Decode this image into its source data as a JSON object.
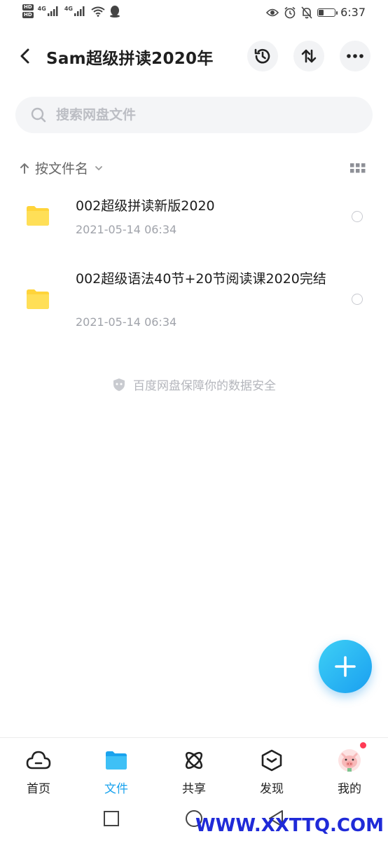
{
  "status_bar": {
    "left": {
      "sim1": "HD",
      "sim2": "HD",
      "net1": "4G",
      "net2": "4G"
    },
    "time": "6:37",
    "icons": [
      "eye-icon",
      "alarm-icon",
      "bell-off-icon",
      "battery-icon"
    ],
    "battery_level": 0.3
  },
  "header": {
    "title": "Sam超级拼读2020年",
    "buttons": [
      "history-icon",
      "transfer-icon",
      "more-icon"
    ]
  },
  "search": {
    "placeholder": "搜索网盘文件"
  },
  "sort": {
    "label": "按文件名"
  },
  "files": [
    {
      "name": "002超级拼读新版2020",
      "date": "2021-05-14  06:34",
      "icon": "folder-icon"
    },
    {
      "name": "002超级语法40节+20节阅读课2020完结",
      "date": "2021-05-14  06:34",
      "icon": "folder-icon"
    }
  ],
  "secure_note": "百度网盘保障你的数据安全",
  "fab": {
    "icon": "plus-icon"
  },
  "nav": [
    {
      "label": "首页",
      "icon": "cloud-icon",
      "active": false
    },
    {
      "label": "文件",
      "icon": "folder-icon",
      "active": true
    },
    {
      "label": "共享",
      "icon": "share-icon",
      "active": false
    },
    {
      "label": "发现",
      "icon": "discover-icon",
      "active": false
    },
    {
      "label": "我的",
      "icon": "avatar-icon",
      "active": false,
      "badge": true
    }
  ],
  "colors": {
    "accent": "#1aa3ee",
    "folder": "#ffd43a",
    "badge": "#ff3b55"
  },
  "watermark": "WWW.XXTTQ.COM"
}
